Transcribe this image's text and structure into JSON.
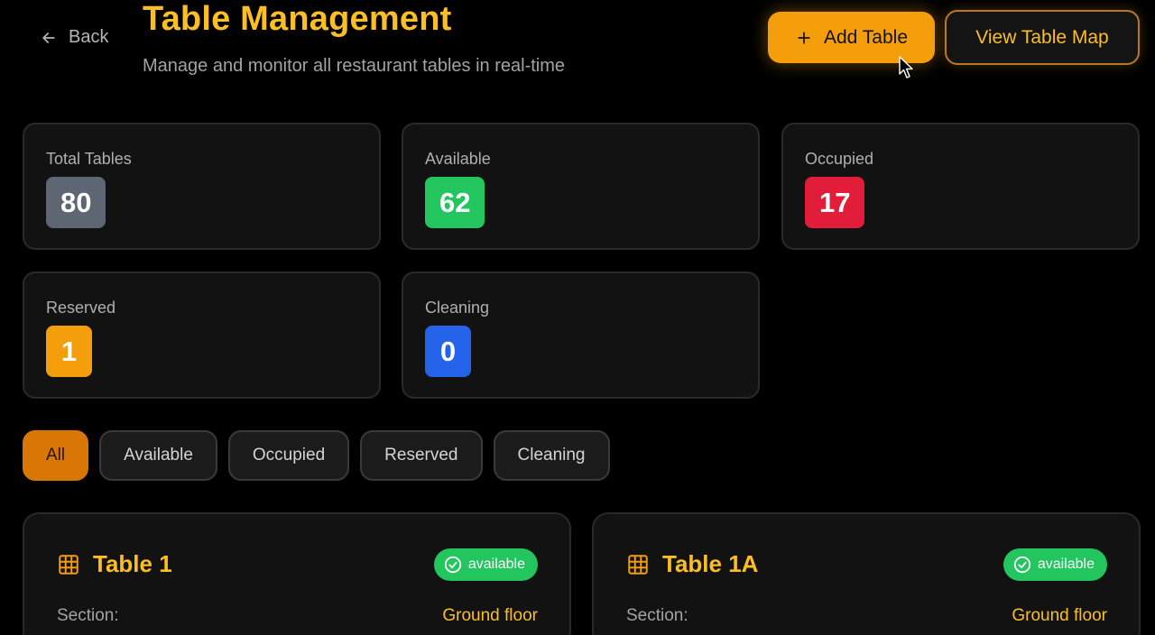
{
  "header": {
    "back_label": "Back",
    "title": "Table Management",
    "subtitle": "Manage and monitor all restaurant tables in real-time",
    "add_label": "Add Table",
    "map_label": "View Table Map"
  },
  "stats": [
    {
      "label": "Total Tables",
      "value": "80",
      "color": "#5f6673"
    },
    {
      "label": "Available",
      "value": "62",
      "color": "#22c55e"
    },
    {
      "label": "Occupied",
      "value": "17",
      "color": "#e11d3a"
    },
    {
      "label": "Reserved",
      "value": "1",
      "color": "#f59e0b"
    },
    {
      "label": "Cleaning",
      "value": "0",
      "color": "#2563eb"
    }
  ],
  "filters": [
    "All",
    "Available",
    "Occupied",
    "Reserved",
    "Cleaning"
  ],
  "active_filter": "All",
  "tables": [
    {
      "name": "Table 1",
      "status": "available",
      "section_label": "Section:",
      "section": "Ground floor"
    },
    {
      "name": "Table 1A",
      "status": "available",
      "section_label": "Section:",
      "section": "Ground floor"
    }
  ],
  "icons": {
    "back": "arrow-left-icon",
    "add": "plus-icon",
    "table": "table-grid-icon",
    "status": "check-circle-icon"
  },
  "colors": {
    "accent": "#fbbf24",
    "primary_button": "#f59e0b",
    "active_filter": "#d97706",
    "available": "#22c55e"
  }
}
